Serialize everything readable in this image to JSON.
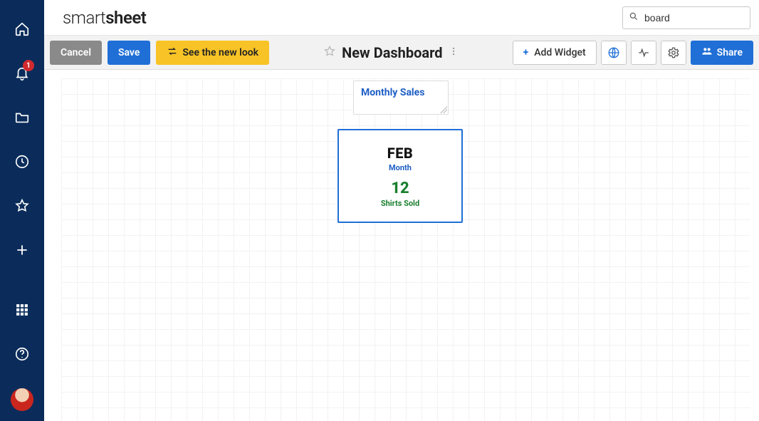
{
  "brand": {
    "thin": "smart",
    "bold": "sheet"
  },
  "search": {
    "value": "board"
  },
  "rail": {
    "notification_badge": "1"
  },
  "toolbar": {
    "cancel": "Cancel",
    "save": "Save",
    "new_look": "See the new look",
    "add_widget": "Add Widget",
    "share": "Share"
  },
  "dashboard": {
    "title": "New Dashboard"
  },
  "widgets": {
    "title_widget": {
      "label": "Monthly Sales"
    },
    "metric_widget": {
      "big": "FEB",
      "big_label": "Month",
      "value": "12",
      "value_label": "Shirts Sold"
    }
  }
}
